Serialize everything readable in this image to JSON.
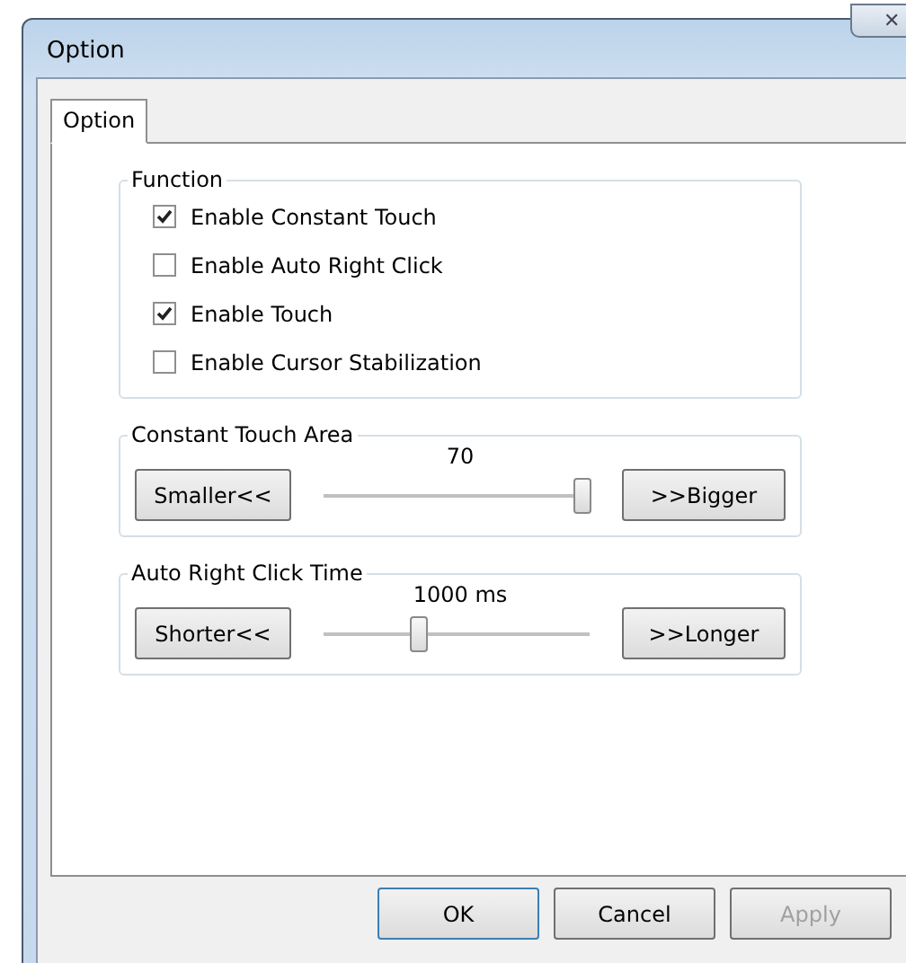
{
  "window": {
    "title": "Option",
    "close_icon": "✕"
  },
  "tabs": [
    {
      "label": "Option",
      "selected": true
    }
  ],
  "function_group": {
    "title": "Function",
    "options": [
      {
        "label": "Enable Constant Touch",
        "checked": true
      },
      {
        "label": "Enable Auto Right Click",
        "checked": false
      },
      {
        "label": "Enable Touch",
        "checked": true
      },
      {
        "label": "Enable Cursor Stabilization",
        "checked": false
      }
    ]
  },
  "slider_groups": [
    {
      "title": "Constant Touch Area",
      "reading": "70",
      "decrease": "Smaller<<",
      "increase": ">>Bigger",
      "level": 0.97
    },
    {
      "title": "Auto Right Click Time",
      "reading": "1000 ms",
      "decrease": "Shorter<<",
      "increase": ">>Longer",
      "level": 0.36
    }
  ],
  "buttons": [
    {
      "label": "OK",
      "disabled": false,
      "default": true
    },
    {
      "label": "Cancel",
      "disabled": false,
      "default": false
    },
    {
      "label": "Apply",
      "disabled": true,
      "default": false
    }
  ]
}
